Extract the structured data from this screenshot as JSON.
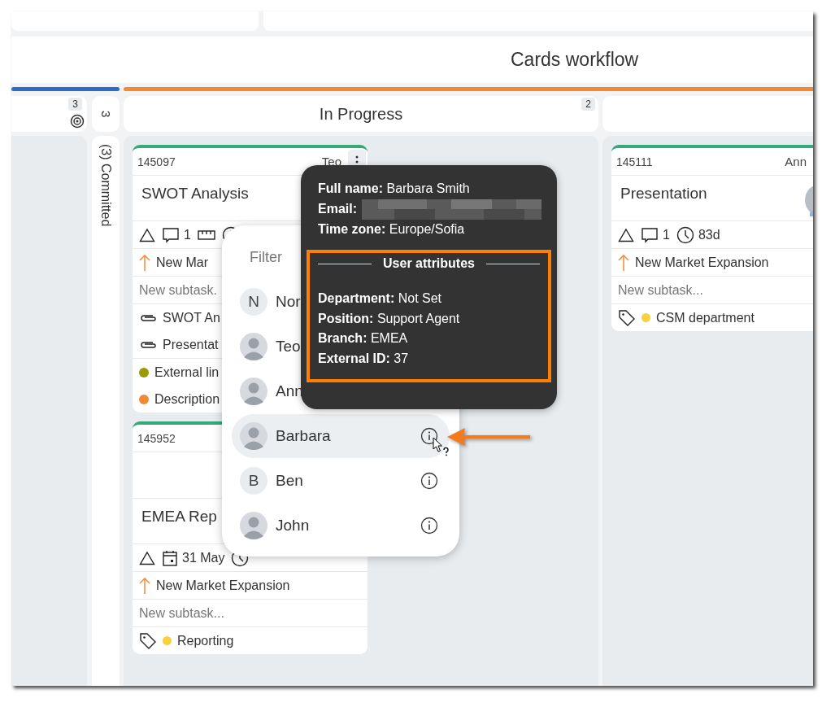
{
  "board": {
    "title": "Cards workflow",
    "lanes": [
      {
        "color": "#2d6cc0",
        "columns": [
          {
            "kind": "empty",
            "count": "3"
          },
          {
            "kind": "collapsed",
            "count": "3",
            "label": "(3) Committed"
          }
        ]
      },
      {
        "color": "#f38a2f",
        "columns": [
          {
            "kind": "cards",
            "title": "In Progress",
            "count": "2",
            "cards": [
              {
                "id": "145097",
                "assignee": "Teo",
                "menu": true,
                "cover": false,
                "title": "SWOT Analysis",
                "metrics": [
                  {
                    "kind": "priority"
                  },
                  {
                    "kind": "comments",
                    "value": "1"
                  },
                  {
                    "kind": "size"
                  },
                  {
                    "kind": "clock"
                  }
                ],
                "parent": "New Mar",
                "subtask_placeholder": "New subtask.",
                "attachments": [
                  "SWOT An",
                  "Presentat"
                ],
                "links": [
                  {
                    "label": "External lin",
                    "color": "#9a9a06"
                  },
                  {
                    "label": "Description",
                    "color": "#f08a34"
                  }
                ]
              },
              {
                "id": "145952",
                "menu": false,
                "cover": true,
                "title": "EMEA Rep",
                "metrics": [
                  {
                    "kind": "priority"
                  },
                  {
                    "kind": "date",
                    "value": "31 May"
                  },
                  {
                    "kind": "clock"
                  }
                ],
                "parent": "New Market Expansion",
                "subtask_placeholder": "New subtask...",
                "tags": [
                  {
                    "label": "Reporting",
                    "color": "#f7d23a"
                  }
                ]
              }
            ]
          },
          {
            "kind": "cards",
            "cards": [
              {
                "id": "145111",
                "assignee": "Ann",
                "menu": false,
                "cover": false,
                "avatar": true,
                "title": "Presentation",
                "metrics": [
                  {
                    "kind": "priority"
                  },
                  {
                    "kind": "comments",
                    "value": "1"
                  },
                  {
                    "kind": "clock",
                    "value": "83d"
                  }
                ],
                "parent": "New Market Expansion",
                "subtask_placeholder": "New subtask...",
                "tags": [
                  {
                    "label": "CSM department",
                    "color": "#f7d23a"
                  }
                ]
              }
            ]
          }
        ]
      }
    ]
  },
  "user_picker": {
    "filter_placeholder": "Filter",
    "users": [
      {
        "name": "Nor",
        "kind": "initial",
        "initial": "N",
        "selected": false
      },
      {
        "name": "Teo",
        "kind": "photo",
        "selected": false
      },
      {
        "name": "Ann",
        "kind": "photo",
        "selected": false
      },
      {
        "name": "Barbara",
        "kind": "photo",
        "selected": true,
        "info": true
      },
      {
        "name": "Ben",
        "kind": "initial",
        "initial": "B",
        "selected": false,
        "info": true
      },
      {
        "name": "John",
        "kind": "photo",
        "selected": false,
        "info": true
      }
    ]
  },
  "user_tooltip": {
    "fields": [
      {
        "text": "**Full name:** Barbara Smith"
      },
      {
        "text": "**Email:**",
        "redacted": true
      },
      {
        "text": "**Time zone:** Europe/Sofia"
      }
    ],
    "attributes_title": "User attributes",
    "highlighted": true,
    "attributes": [
      "**Department:** Not Set",
      "**Position:** Support Agent",
      "**Branch:** EMEA",
      "**External ID:** 37"
    ]
  }
}
